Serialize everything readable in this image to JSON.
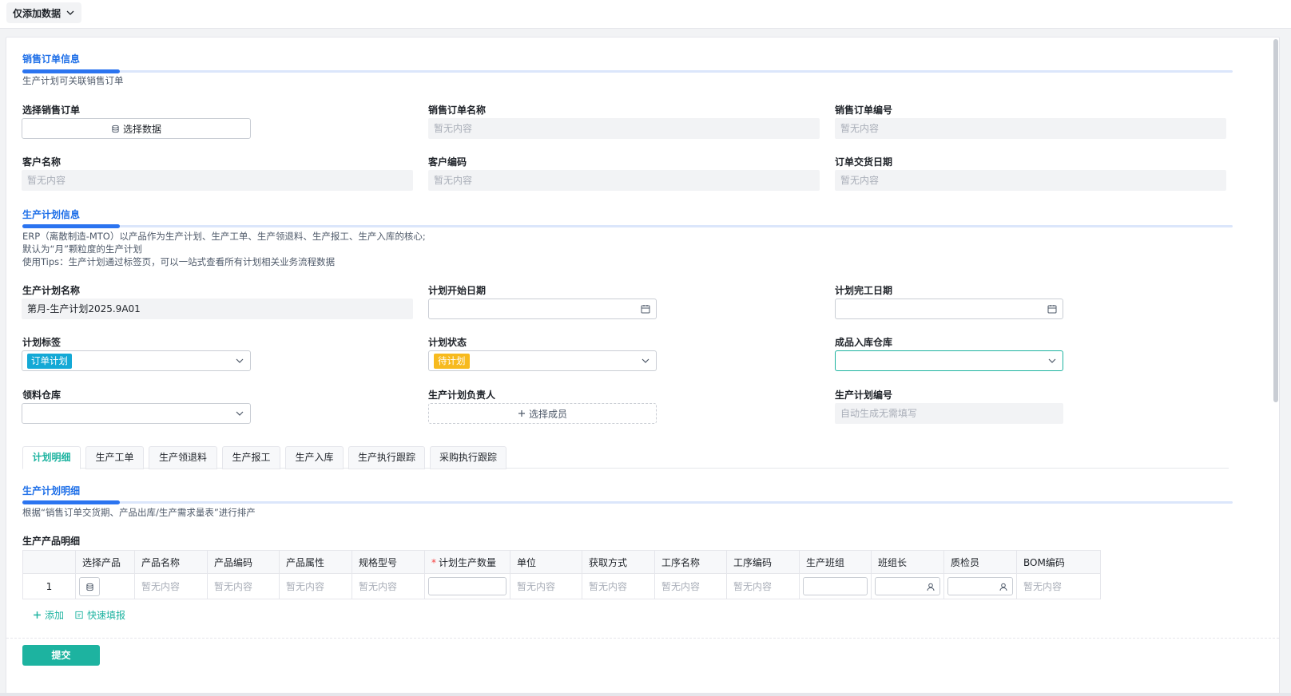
{
  "topbar": {
    "mode_label": "仅添加数据"
  },
  "sales_section": {
    "title": "销售订单信息",
    "desc": "生产计划可关联销售订单",
    "fields": {
      "select_order": {
        "label": "选择销售订单",
        "button": "选择数据"
      },
      "order_name": {
        "label": "销售订单名称",
        "value": "暂无内容"
      },
      "order_no": {
        "label": "销售订单编号",
        "value": "暂无内容"
      },
      "customer_name": {
        "label": "客户名称",
        "value": "暂无内容"
      },
      "customer_code": {
        "label": "客户编码",
        "value": "暂无内容"
      },
      "delivery_date": {
        "label": "订单交货日期",
        "value": "暂无内容"
      }
    }
  },
  "plan_section": {
    "title": "生产计划信息",
    "desc_lines": [
      "ERP（离散制造-MTO）以产品作为生产计划、生产工单、生产领退料、生产报工、生产入库的核心;",
      "默认为“月”颗粒度的生产计划",
      "使用Tips：生产计划通过标签页，可以一站式查看所有计划相关业务流程数据"
    ],
    "fields": {
      "plan_name": {
        "label": "生产计划名称",
        "value": "第月-生产计划2025.9A01"
      },
      "start_date": {
        "label": "计划开始日期",
        "value": ""
      },
      "end_date": {
        "label": "计划完工日期",
        "value": ""
      },
      "plan_tag": {
        "label": "计划标签",
        "tag": "订单计划",
        "tag_color": "#14a9d6"
      },
      "plan_status": {
        "label": "计划状态",
        "tag": "待计划",
        "tag_color": "#f7ba1e"
      },
      "finished_warehouse": {
        "label": "成品入库仓库",
        "value": ""
      },
      "material_warehouse": {
        "label": "领料仓库",
        "value": ""
      },
      "owner": {
        "label": "生产计划负责人",
        "button": "选择成员"
      },
      "plan_no": {
        "label": "生产计划编号",
        "value": "自动生成无需填写"
      }
    }
  },
  "tabs": [
    "计划明细",
    "生产工单",
    "生产领退料",
    "生产报工",
    "生产入库",
    "生产执行跟踪",
    "采购执行跟踪"
  ],
  "detail_section": {
    "title": "生产计划明细",
    "desc": "根据“销售订单交货期、产品出库/生产需求量表”进行排产",
    "table_title": "生产产品明细",
    "columns": [
      "",
      "选择产品",
      "产品名称",
      "产品编码",
      "产品属性",
      "规格型号",
      "计划生产数量",
      "单位",
      "获取方式",
      "工序名称",
      "工序编码",
      "生产班组",
      "班组长",
      "质检员",
      "BOM编码"
    ],
    "row": {
      "index": "1",
      "empty": "暂无内容"
    },
    "add_label": "添加",
    "quick_fill_label": "快速填报"
  },
  "submit_label": "提交",
  "colors": {
    "accent": "#1db3a0",
    "section_blue": "#1e6fe8"
  }
}
